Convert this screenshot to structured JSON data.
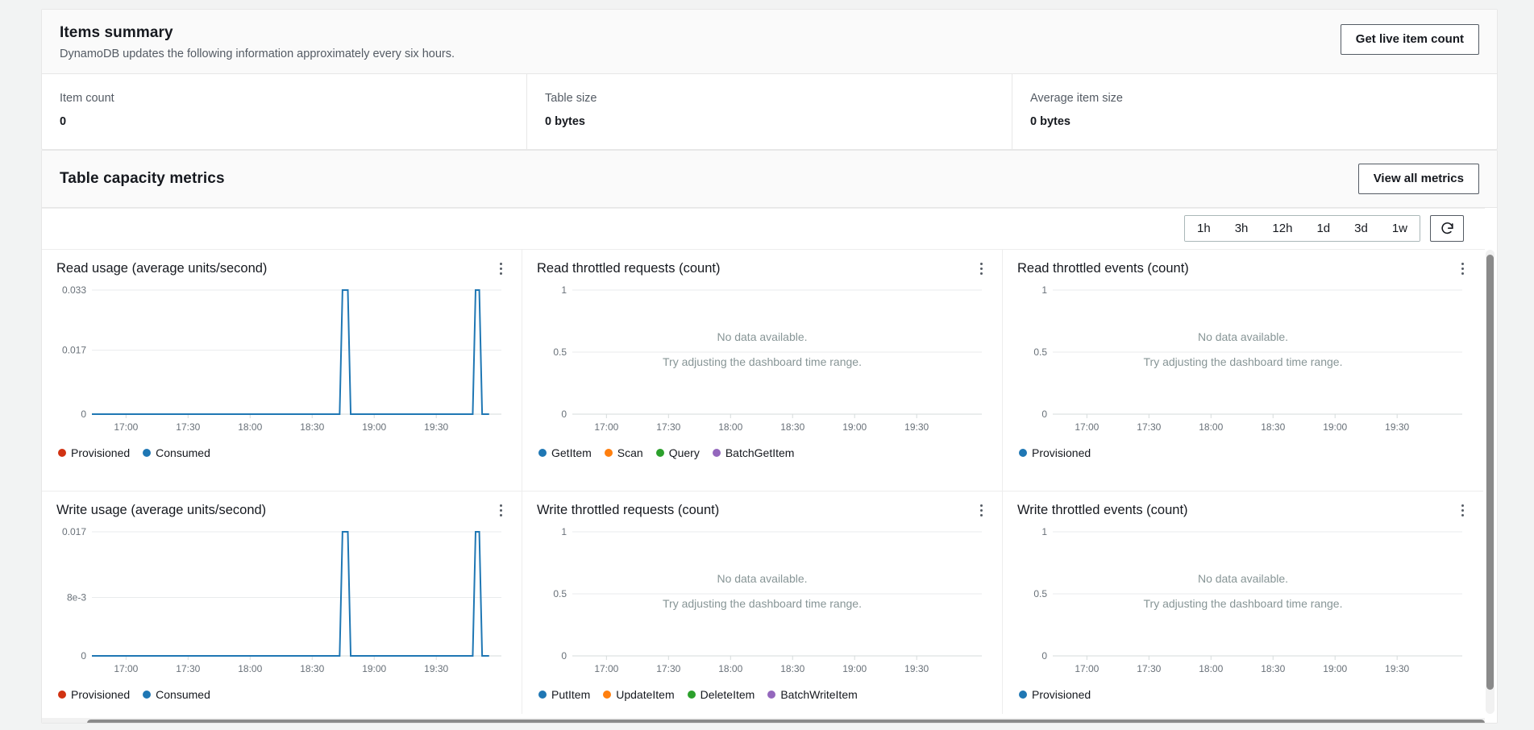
{
  "items_summary": {
    "title": "Items summary",
    "subtitle": "DynamoDB updates the following information approximately every six hours.",
    "action_label": "Get live item count",
    "stats": [
      {
        "label": "Item count",
        "value": "0"
      },
      {
        "label": "Table size",
        "value": "0 bytes"
      },
      {
        "label": "Average item size",
        "value": "0 bytes"
      }
    ]
  },
  "capacity": {
    "title": "Table capacity metrics",
    "action_label": "View all metrics",
    "time_ranges": [
      "1h",
      "3h",
      "12h",
      "1d",
      "3d",
      "1w"
    ],
    "refresh_icon": "refresh-icon",
    "empty_primary": "No data available.",
    "empty_secondary": "Try adjusting the dashboard time range.",
    "kebab_icon": "kebab-menu-icon"
  },
  "colors": {
    "provisioned_red": "#d13212",
    "consumed_blue": "#1f77b4",
    "getitem_blue": "#1f77b4",
    "scan_orange": "#ff7f0e",
    "query_green": "#2ca02c",
    "batchgetitem_purple": "#9467bd",
    "grid": "#e9ebed",
    "axis_text": "#687078"
  },
  "chart_data": [
    {
      "type": "line",
      "title": "Read usage (average units/second)",
      "xlabel": "",
      "ylabel": "",
      "ylim": [
        0,
        0.033
      ],
      "ytick_labels": [
        "0.033",
        "0.017",
        "0"
      ],
      "ytick_values": [
        0.033,
        0.017,
        0
      ],
      "xtick_labels": [
        "17:00",
        "17:30",
        "18:00",
        "18:30",
        "19:00",
        "19:30"
      ],
      "grid": true,
      "legend_position": "bottom",
      "legend": [
        {
          "name": "Provisioned",
          "color": "#d13212"
        },
        {
          "name": "Consumed",
          "color": "#1f77b4"
        }
      ],
      "series": [
        {
          "name": "Consumed",
          "color": "#1f77b4",
          "points": [
            [
              0,
              0
            ],
            [
              60.5,
              0
            ],
            [
              61.2,
              0.033
            ],
            [
              62.5,
              0.033
            ],
            [
              63.2,
              0
            ],
            [
              93.0,
              0
            ],
            [
              93.7,
              0.033
            ],
            [
              94.6,
              0.033
            ],
            [
              95.3,
              0
            ],
            [
              97,
              0
            ]
          ]
        },
        {
          "name": "Provisioned",
          "color": "#d13212",
          "points": []
        }
      ],
      "has_data": true
    },
    {
      "type": "line",
      "title": "Read throttled requests (count)",
      "ylim": [
        0,
        1
      ],
      "ytick_labels": [
        "1",
        "0.5",
        "0"
      ],
      "ytick_values": [
        1,
        0.5,
        0
      ],
      "xtick_labels": [
        "17:00",
        "17:30",
        "18:00",
        "18:30",
        "19:00",
        "19:30"
      ],
      "grid": true,
      "legend_position": "bottom",
      "legend": [
        {
          "name": "GetItem",
          "color": "#1f77b4"
        },
        {
          "name": "Scan",
          "color": "#ff7f0e"
        },
        {
          "name": "Query",
          "color": "#2ca02c"
        },
        {
          "name": "BatchGetItem",
          "color": "#9467bd"
        }
      ],
      "series": [],
      "has_data": false
    },
    {
      "type": "line",
      "title": "Read throttled events (count)",
      "ylim": [
        0,
        1
      ],
      "ytick_labels": [
        "1",
        "0.5",
        "0"
      ],
      "ytick_values": [
        1,
        0.5,
        0
      ],
      "xtick_labels": [
        "17:00",
        "17:30",
        "18:00",
        "18:30",
        "19:00",
        "19:30"
      ],
      "grid": true,
      "legend_position": "bottom",
      "legend": [
        {
          "name": "Provisioned",
          "color": "#1f77b4"
        }
      ],
      "series": [],
      "has_data": false
    },
    {
      "type": "line",
      "title": "Write usage (average units/second)",
      "ylim": [
        0,
        0.017
      ],
      "ytick_labels": [
        "0.017",
        "8e-3",
        "0"
      ],
      "ytick_values": [
        0.017,
        0.008,
        0
      ],
      "xtick_labels": [
        "17:00",
        "17:30",
        "18:00",
        "18:30",
        "19:00",
        "19:30"
      ],
      "grid": true,
      "legend_position": "bottom",
      "legend": [
        {
          "name": "Provisioned",
          "color": "#d13212"
        },
        {
          "name": "Consumed",
          "color": "#1f77b4"
        }
      ],
      "series": [
        {
          "name": "Consumed",
          "color": "#1f77b4",
          "points": [
            [
              0,
              0
            ],
            [
              60.5,
              0
            ],
            [
              61.2,
              0.017
            ],
            [
              62.5,
              0.017
            ],
            [
              63.2,
              0
            ],
            [
              93.0,
              0
            ],
            [
              93.7,
              0.017
            ],
            [
              94.6,
              0.017
            ],
            [
              95.3,
              0
            ],
            [
              97,
              0
            ]
          ]
        },
        {
          "name": "Provisioned",
          "color": "#d13212",
          "points": []
        }
      ],
      "has_data": true
    },
    {
      "type": "line",
      "title": "Write throttled requests (count)",
      "ylim": [
        0,
        1
      ],
      "ytick_labels": [
        "1",
        "0.5",
        "0"
      ],
      "ytick_values": [
        1,
        0.5,
        0
      ],
      "xtick_labels": [
        "17:00",
        "17:30",
        "18:00",
        "18:30",
        "19:00",
        "19:30"
      ],
      "grid": true,
      "legend_position": "bottom",
      "legend": [
        {
          "name": "PutItem",
          "color": "#1f77b4"
        },
        {
          "name": "UpdateItem",
          "color": "#ff7f0e"
        },
        {
          "name": "DeleteItem",
          "color": "#2ca02c"
        },
        {
          "name": "BatchWriteItem",
          "color": "#9467bd"
        }
      ],
      "series": [],
      "has_data": false
    },
    {
      "type": "line",
      "title": "Write throttled events (count)",
      "ylim": [
        0,
        1
      ],
      "ytick_labels": [
        "1",
        "0.5",
        "0"
      ],
      "ytick_values": [
        1,
        0.5,
        0
      ],
      "xtick_labels": [
        "17:00",
        "17:30",
        "18:00",
        "18:30",
        "19:00",
        "19:30"
      ],
      "grid": true,
      "legend_position": "bottom",
      "legend": [
        {
          "name": "Provisioned",
          "color": "#1f77b4"
        }
      ],
      "series": [],
      "has_data": false
    }
  ]
}
